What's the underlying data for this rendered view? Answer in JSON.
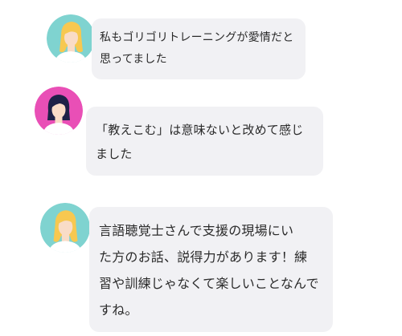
{
  "colors": {
    "bubble_background": "#f1f1f4",
    "avatar_teal": "#7fd3d0",
    "avatar_pink": "#e94fb6",
    "hair_blonde": "#f7c850",
    "hair_dark": "#1d2147",
    "skin": "#f9dcc7"
  },
  "messages": [
    {
      "avatar_icon": "woman-blonde-avatar-icon",
      "lines": [
        "私もゴリゴリトレーニングが愛情だと",
        "思ってました"
      ]
    },
    {
      "avatar_icon": "woman-dark-hair-avatar-icon",
      "lines": [
        "「教えこむ」は意味ないと改めて感じ",
        "ました"
      ]
    },
    {
      "avatar_icon": "woman-blonde-avatar-icon",
      "lines": [
        "言語聴覚士さんで支援の現場にい",
        "た方のお話、説得力があります！練",
        "習や訓練じゃなくて楽しいことなんで",
        "すね。"
      ]
    }
  ]
}
